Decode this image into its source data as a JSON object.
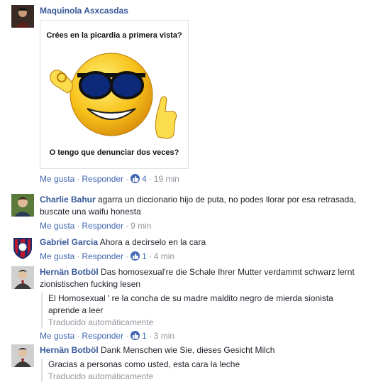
{
  "actions": {
    "like": "Me gusta",
    "reply": "Responder",
    "translated": "Traducido automáticamente"
  },
  "comments": [
    {
      "author": "Maquinola Asxcasdas",
      "meme_top": "Crées en la picardia a primera vista?",
      "meme_bottom": "O tengo que denunciar dos veces?",
      "likes": "4",
      "time": "19 min"
    },
    {
      "author": "Charlie Bahur",
      "text": "agarra un diccionario hijo de puta, no podes llorar por esa retrasada, buscate una waifu honesta",
      "time": "9 min"
    },
    {
      "author": "Gabriel Garcia",
      "text": "Ahora a decirselo en la cara",
      "likes": "1",
      "time": "4 min"
    },
    {
      "author": "Hernän Botböl",
      "text": "Das homosexual're die Schale Ihrer Mutter verdammt schwarz lernt zionistischen fucking lesen",
      "translation": "El Homosexual ' re la concha de su madre maldito negro de mierda sionista aprende a leer",
      "likes": "1",
      "time": "3 min"
    },
    {
      "author": "Hernän Botböl",
      "text": "Dank Menschen wie Sie, dieses Gesicht Milch",
      "translation": "Gracias a personas como usted, esta cara la leche"
    }
  ],
  "colors": {
    "link": "#365899",
    "action": "#4267b2",
    "meta": "#90949c"
  }
}
